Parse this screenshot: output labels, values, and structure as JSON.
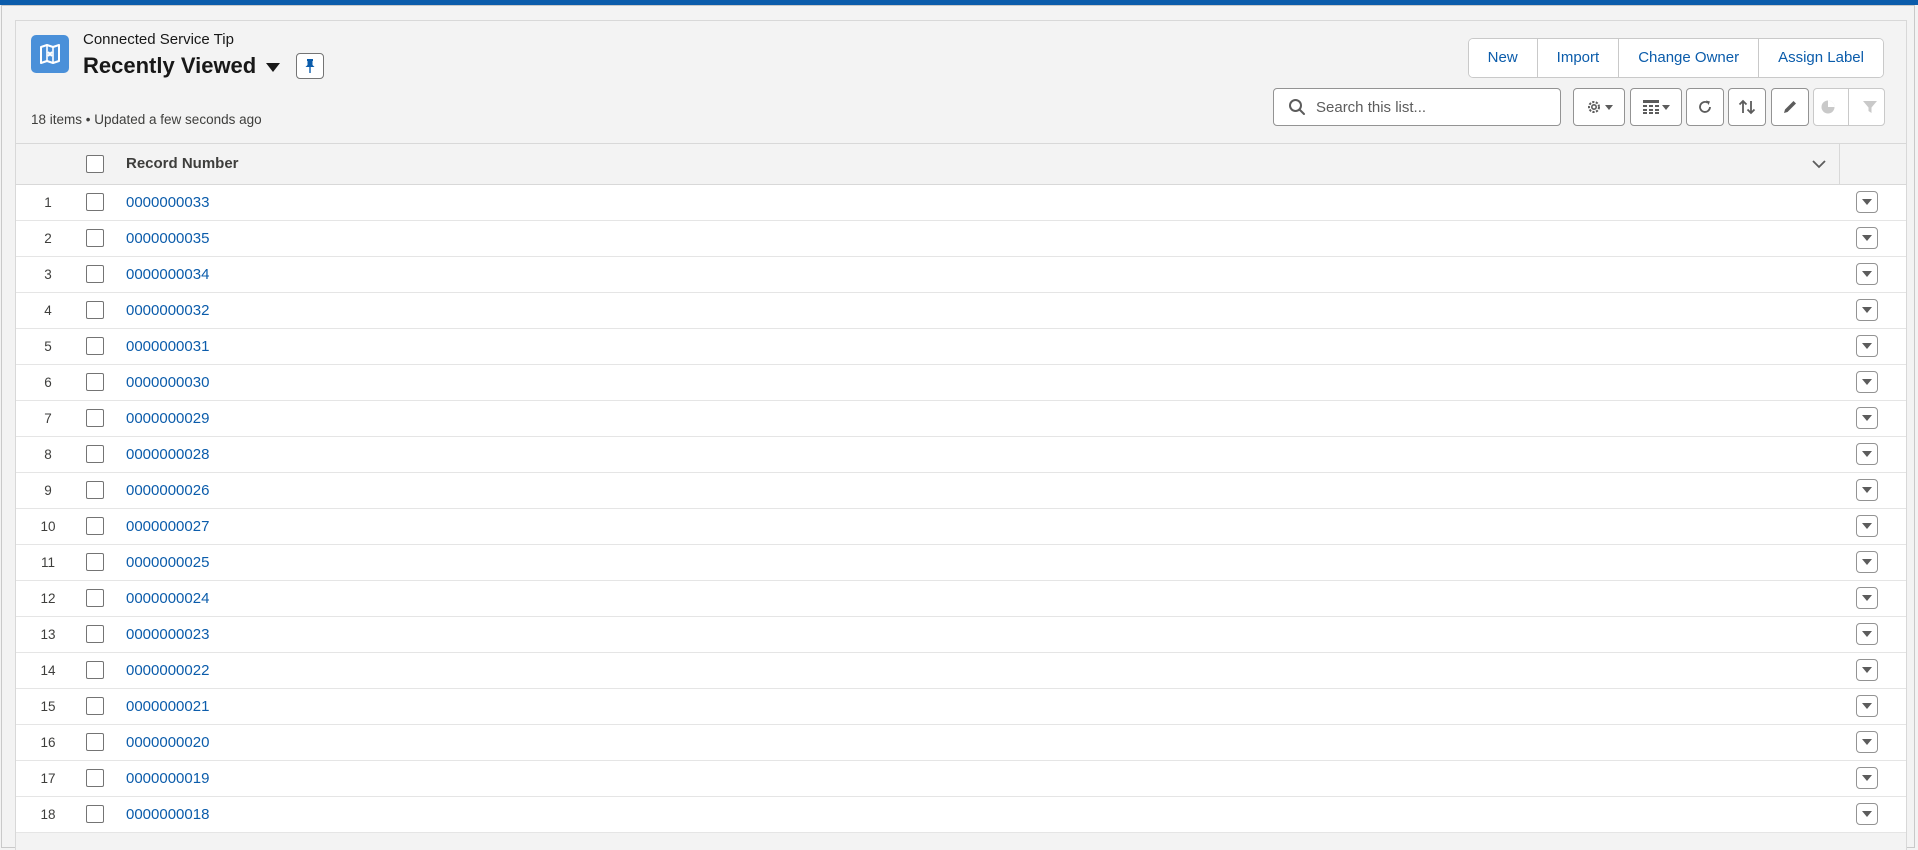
{
  "header": {
    "object_label": "Connected Service Tip",
    "list_view_title": "Recently Viewed",
    "meta": "18 items • Updated a few seconds ago"
  },
  "actions": {
    "new_label": "New",
    "import_label": "Import",
    "change_owner_label": "Change Owner",
    "assign_label_label": "Assign Label"
  },
  "search": {
    "placeholder": "Search this list..."
  },
  "toolbar": {
    "icons": [
      "gear-icon",
      "table-display-icon",
      "refresh-icon",
      "sort-icon",
      "edit-icon",
      "chart-icon",
      "filter-icon"
    ]
  },
  "table": {
    "column_header": "Record Number",
    "rows": [
      {
        "num": "1",
        "record": "0000000033"
      },
      {
        "num": "2",
        "record": "0000000035"
      },
      {
        "num": "3",
        "record": "0000000034"
      },
      {
        "num": "4",
        "record": "0000000032"
      },
      {
        "num": "5",
        "record": "0000000031"
      },
      {
        "num": "6",
        "record": "0000000030"
      },
      {
        "num": "7",
        "record": "0000000029"
      },
      {
        "num": "8",
        "record": "0000000028"
      },
      {
        "num": "9",
        "record": "0000000026"
      },
      {
        "num": "10",
        "record": "0000000027"
      },
      {
        "num": "11",
        "record": "0000000025"
      },
      {
        "num": "12",
        "record": "0000000024"
      },
      {
        "num": "13",
        "record": "0000000023"
      },
      {
        "num": "14",
        "record": "0000000022"
      },
      {
        "num": "15",
        "record": "0000000021"
      },
      {
        "num": "16",
        "record": "0000000020"
      },
      {
        "num": "17",
        "record": "0000000019"
      },
      {
        "num": "18",
        "record": "0000000018"
      }
    ]
  },
  "colors": {
    "brand_bar": "#0b5cab",
    "link": "#0b5cab",
    "object_icon": "#4a90d9"
  }
}
